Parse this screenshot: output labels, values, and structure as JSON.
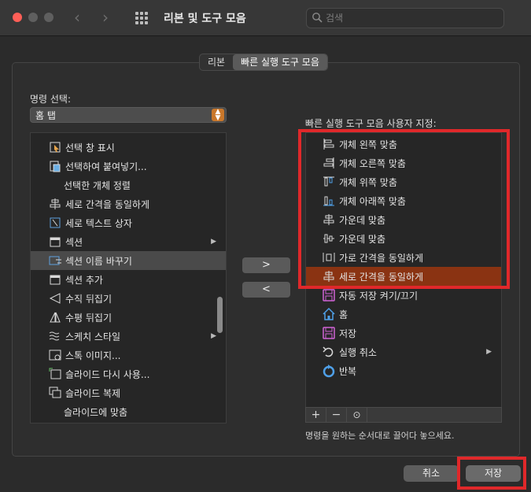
{
  "window": {
    "title": "리본 및 도구 모음"
  },
  "search": {
    "placeholder": "검색"
  },
  "tabs": [
    {
      "label": "리본",
      "active": false
    },
    {
      "label": "빠른 실행 도구 모음",
      "active": true
    }
  ],
  "left": {
    "select_label": "명령 선택:",
    "select_value": "홈 탭",
    "items": [
      {
        "label": "선택 창 표시",
        "icon": "selection-pane-icon"
      },
      {
        "label": "선택하여 붙여넣기...",
        "icon": "paste-special-icon"
      },
      {
        "label": "선택한 개체 정렬",
        "icon": ""
      },
      {
        "label": "세로 간격을 동일하게",
        "icon": "distribute-vertical-icon"
      },
      {
        "label": "세로 텍스트 상자",
        "icon": "vertical-textbox-icon"
      },
      {
        "label": "섹션",
        "icon": "section-icon",
        "submenu": true
      },
      {
        "label": "섹션 이름 바꾸기",
        "icon": "rename-section-icon",
        "selected": true
      },
      {
        "label": "섹션 추가",
        "icon": "add-section-icon"
      },
      {
        "label": "수직 뒤집기",
        "icon": "flip-vertical-icon"
      },
      {
        "label": "수평 뒤집기",
        "icon": "flip-horizontal-icon"
      },
      {
        "label": "스케치 스타일",
        "icon": "sketch-style-icon",
        "submenu": true
      },
      {
        "label": "스톡 이미지...",
        "icon": "stock-image-icon"
      },
      {
        "label": "슬라이드 다시 사용...",
        "icon": "reuse-slides-icon"
      },
      {
        "label": "슬라이드 복제",
        "icon": "duplicate-slide-icon"
      },
      {
        "label": "슬라이드에 맞춤",
        "icon": ""
      }
    ]
  },
  "right": {
    "label": "빠른 실행 도구 모음 사용자 지정:",
    "items": [
      {
        "label": "개체 왼쪽 맞춤",
        "icon": "align-left-icon"
      },
      {
        "label": "개체 오른쪽 맞춤",
        "icon": "align-right-icon"
      },
      {
        "label": "개체 위쪽 맞춤",
        "icon": "align-top-icon"
      },
      {
        "label": "개체 아래쪽 맞춤",
        "icon": "align-bottom-icon"
      },
      {
        "label": "가운데 맞춤",
        "icon": "align-center-icon"
      },
      {
        "label": "가운데 맞춤",
        "icon": "align-middle-icon"
      },
      {
        "label": "가로 간격을 동일하게",
        "icon": "distribute-horizontal-icon"
      },
      {
        "label": "세로 간격을 동일하게",
        "icon": "distribute-vertical-icon",
        "selected": true
      },
      {
        "label": "자동 저장 켜기/끄기",
        "icon": "autosave-icon"
      },
      {
        "label": "홈",
        "icon": "home-icon"
      },
      {
        "label": "저장",
        "icon": "save-icon"
      },
      {
        "label": "실행 취소",
        "icon": "undo-icon",
        "submenu": true
      },
      {
        "label": "반복",
        "icon": "redo-icon"
      }
    ],
    "hint": "명령을 원하는 순서대로 끌어다 놓으세요."
  },
  "toolbar": {
    "add": "+",
    "remove": "−",
    "more": "⊙"
  },
  "transfer": {
    "add": ">",
    "remove": "<"
  },
  "buttons": {
    "cancel": "취소",
    "save": "저장"
  },
  "colors": {
    "accent": "#c9772a",
    "selected_row": "#8a3312",
    "highlight": "#e0282a"
  }
}
